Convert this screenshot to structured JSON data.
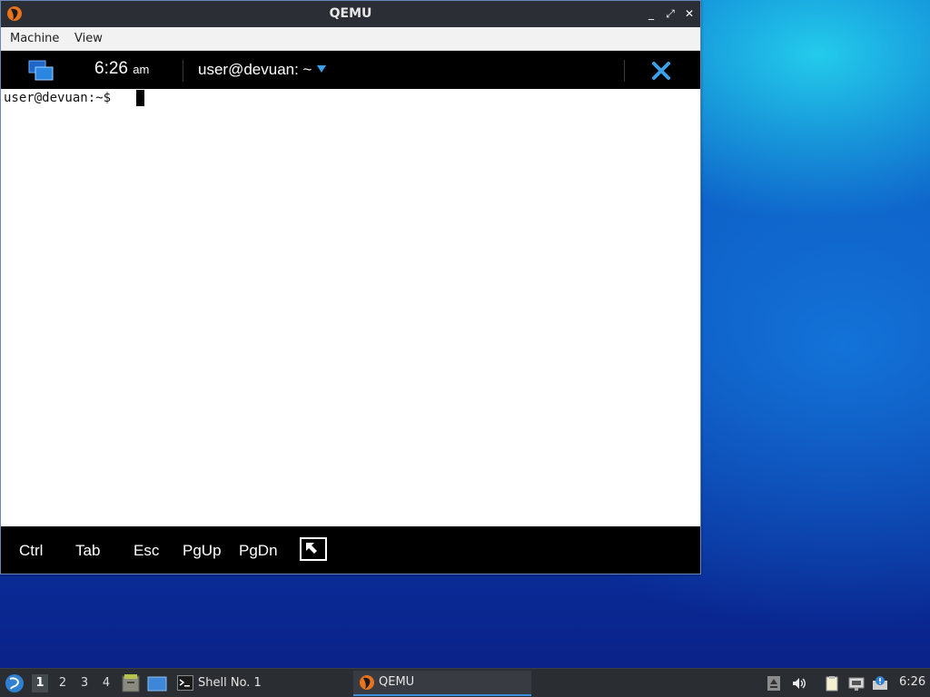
{
  "window": {
    "title": "QEMU",
    "app_icon": "qemu-icon",
    "controls": {
      "minimize": "_",
      "maximize": "⤢",
      "close": "✕"
    }
  },
  "menu": {
    "items": [
      {
        "label": "Machine"
      },
      {
        "label": "View"
      }
    ]
  },
  "guest": {
    "topbar": {
      "windows_icon": "windows-switcher-icon",
      "clock": {
        "time": "6:26",
        "ampm": "am"
      },
      "terminal_title": "user@devuan: ~",
      "dropdown_icon": "chevron-down-icon",
      "close_icon": "close-icon"
    },
    "terminal": {
      "prompt": "user@devuan:~$"
    },
    "keys": [
      {
        "label": "Ctrl"
      },
      {
        "label": "Tab"
      },
      {
        "label": "Esc"
      },
      {
        "label": "PgUp"
      },
      {
        "label": "PgDn"
      }
    ],
    "extra_key_icon": "toggle-keyboard-icon"
  },
  "taskbar": {
    "start_icon": "start-menu-icon",
    "workspaces": [
      "1",
      "2",
      "3",
      "4"
    ],
    "active_workspace": "1",
    "launchers": [
      "file-manager-icon",
      "show-desktop-icon"
    ],
    "tasks": [
      {
        "label": "Shell No. 1",
        "icon": "terminal-icon"
      },
      {
        "label": "QEMU",
        "icon": "qemu-icon"
      }
    ],
    "tray": [
      "eject-icon",
      "volume-icon",
      "clipboard-icon",
      "network-icon",
      "notification-icon"
    ],
    "clock": "6:26"
  },
  "colors": {
    "title_bar": "#2b2f35",
    "guest_bar": "#000000",
    "accent": "#3b8fd8",
    "taskbar": "#2a2d31"
  }
}
